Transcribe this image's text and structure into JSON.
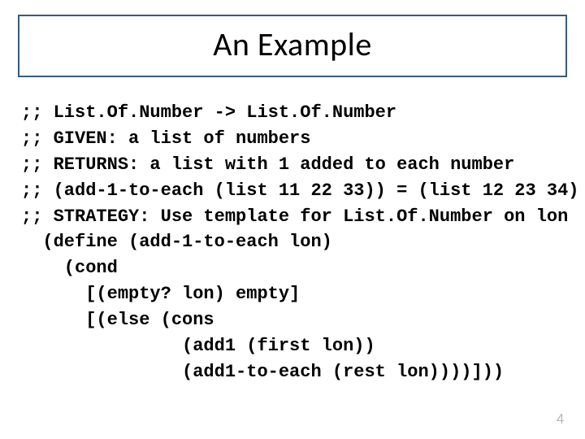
{
  "title": "An Example",
  "code": {
    "l1": ";; List.Of.Number -> List.Of.Number",
    "l2": ";; GIVEN: a list of numbers",
    "l3": ";; RETURNS: a list with 1 added to each number",
    "l4": ";; (add-1-to-each (list 11 22 33)) = (list 12 23 34)",
    "l5": ";; STRATEGY: Use template for List.Of.Number on lon",
    "l6": "  (define (add-1-to-each lon)",
    "l7": "    (cond",
    "l8": "      [(empty? lon) empty]",
    "l9": "      [(else (cons",
    "l10": "               (add1 (first lon))",
    "l11": "               (add1-to-each (rest lon))))]))"
  },
  "page_number": "4"
}
